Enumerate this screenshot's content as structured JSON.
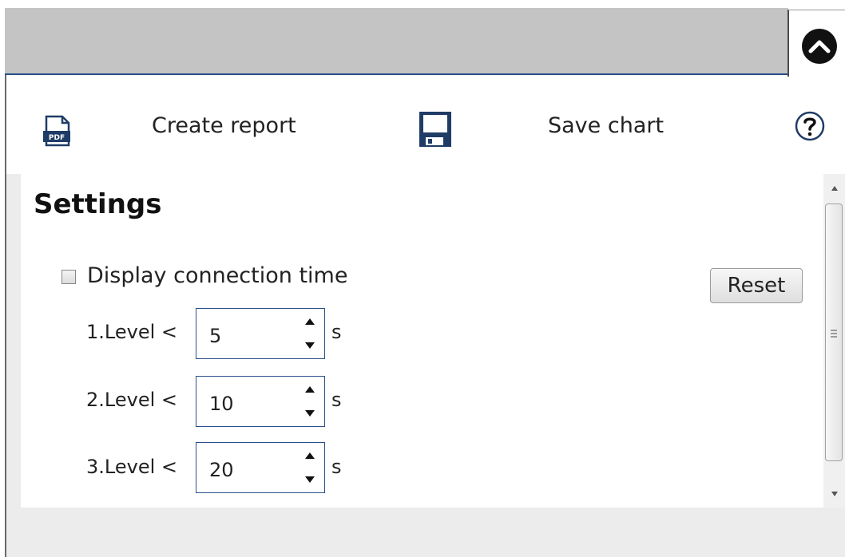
{
  "toolbar": {
    "create_report_label": "Create report",
    "save_chart_label": "Save chart",
    "pdf_icon_text": "PDF"
  },
  "settings": {
    "title": "Settings",
    "display_connection_time": {
      "label": "Display connection time",
      "checked": false
    },
    "reset_label": "Reset",
    "levels": [
      {
        "label": "1.Level <",
        "value": "5",
        "unit": "s"
      },
      {
        "label": "2.Level <",
        "value": "10",
        "unit": "s"
      },
      {
        "label": "3.Level <",
        "value": "20",
        "unit": "s"
      }
    ]
  },
  "icons": {
    "collapse": "chevron-up-icon",
    "pdf": "pdf-file-icon",
    "save": "floppy-disk-icon",
    "help": "help-icon"
  },
  "colors": {
    "accent_border": "#2a4f8a",
    "save_icon": "#1f3c66",
    "tabbar": "#c4c4c4"
  }
}
